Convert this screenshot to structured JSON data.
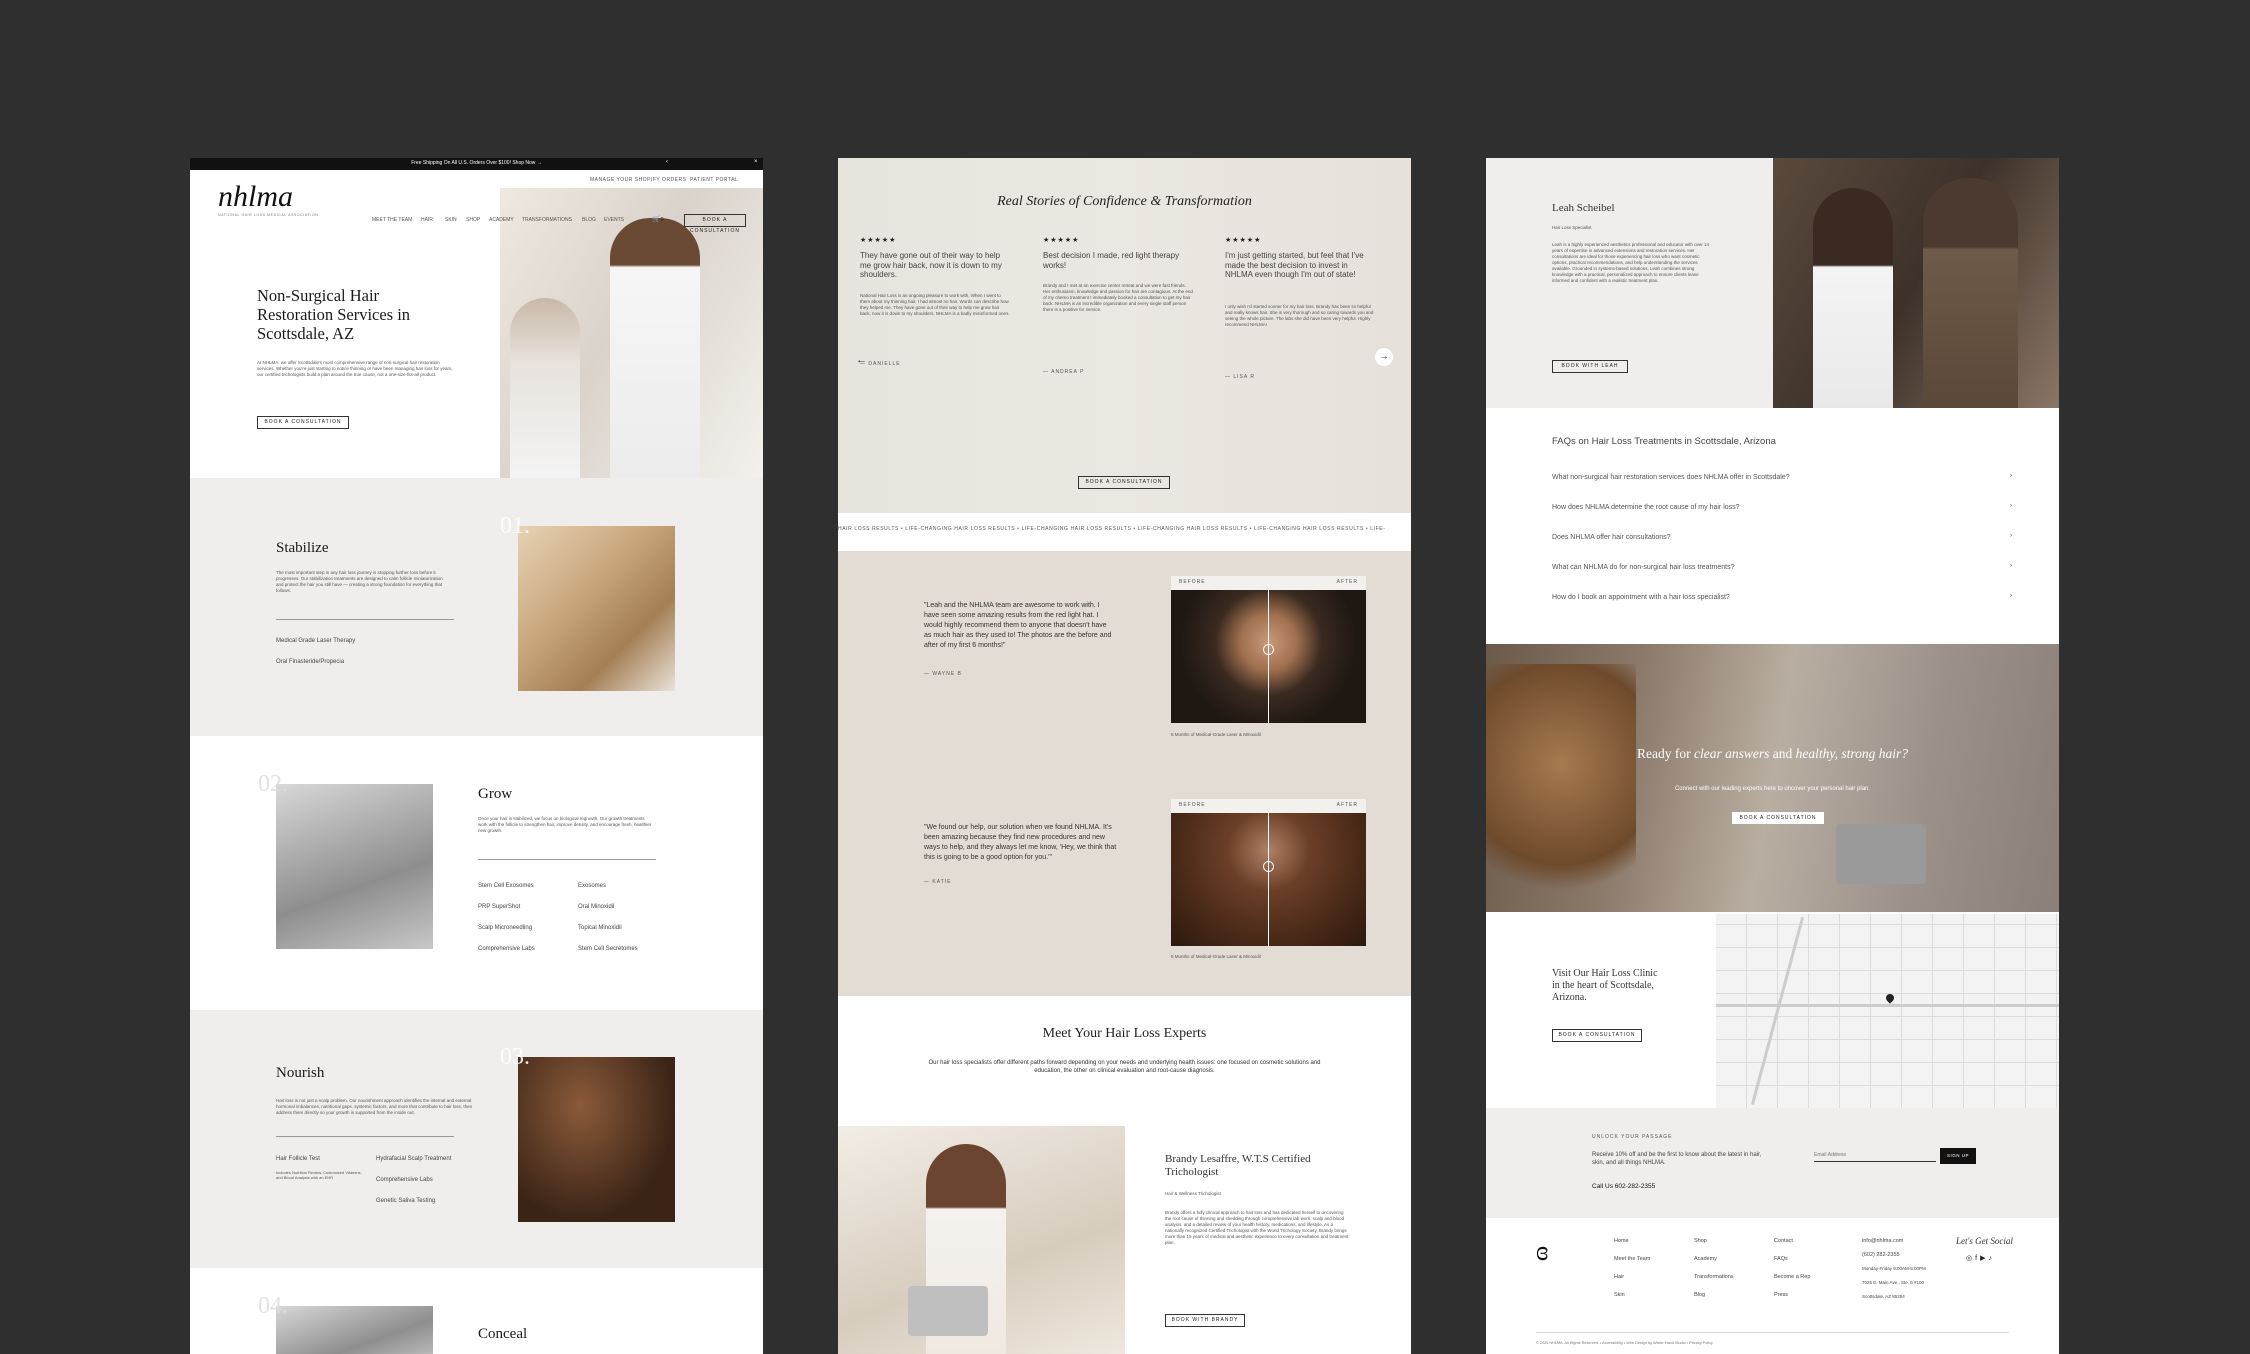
{
  "panel1": {
    "announcement": "Free Shipping On All U.S. Orders Over $100! Shop Now →",
    "top_links": [
      "MANAGE YOUR SHOPIFY ORDERS",
      "PATIENT PORTAL"
    ],
    "logo": "nhlma",
    "logo_tagline": "NATIONAL HAIR LOSS MEDICAL ASSOCIATION",
    "nav": [
      "MEET THE TEAM",
      "HAIR",
      "SKIN",
      "SHOP",
      "ACADEMY",
      "TRANSFORMATIONS",
      "BLOG",
      "EVENTS"
    ],
    "cart_count": "0",
    "nav_cta": "BOOK A CONSULTATION",
    "hero_title": "Non-Surgical Hair Restoration Services in Scottsdale, AZ",
    "hero_body": "At NHLMA, we offer Scottsdale's most comprehensive range of non-surgical hair restoration services. Whether you're just starting to notice thinning or have been managing hair loss for years, our certified trichologists build a plan around the true cause, not a one-size-fits-all product.",
    "hero_cta": "BOOK A CONSULTATION",
    "stabilize": {
      "num": "01.",
      "title": "Stabilize",
      "body": "The most important step in any hair loss journey is stopping further loss before it progresses. Our stabilization treatments are designed to calm follicle miniaturization and protect the hair you still have — creating a strong foundation for everything that follows.",
      "items": [
        "Medical Grade Laser Therapy",
        "Oral Finasteride/Propecia"
      ]
    },
    "grow": {
      "num": "02.",
      "title": "Grow",
      "body": "Once your hair is stabilized, we focus on biological regrowth. Our growth treatments work with the follicle to strengthen hair, improve density, and encourage fresh, healthier new growth.",
      "items_left": [
        "Stem Cell Exosomes",
        "PRP SuperShot",
        "Scalp Microneedling",
        "Comprehensive Labs"
      ],
      "items_right": [
        "Exosomes",
        "Oral Minoxidil",
        "Topical Minoxidil",
        "Stem Cell Secretomes"
      ]
    },
    "nourish": {
      "num": "03.",
      "title": "Nourish",
      "body": "Hair loss is not just a scalp problem. Our nourishment approach identifies the internal and external hormonal imbalances, nutritional gaps, systemic factors, and more that contribute to hair loss, then address them directly so your growth is supported from the inside out.",
      "items_left": [
        "Hair Follicle Test",
        "Includes Nutrition Review, Customized Vitamins, and Blood Analysis with an EHR"
      ],
      "items_right": [
        "Hydrafacial Scalp Treatment",
        "Comprehensive Labs",
        "Genetic Saliva Testing"
      ]
    },
    "conceal": {
      "num": "04.",
      "title": "Conceal"
    }
  },
  "panel2": {
    "reviews_title": "Real Stories of Confidence & Transformation",
    "reviews": [
      {
        "stars": "★★★★★",
        "headline": "They have gone out of their way to help me grow hair back, now it is down to my shoulders.",
        "body": "National Hair Loss is an ongoing pleasure to work with. When I went to them about my thinning hair, I had almost no hair. Words can describe how they helped me. They have gone out of their way to help me grow hair back, now it is down to my shoulders. NHLMA is a badly misinformed ones.",
        "author": "— DANIELLE"
      },
      {
        "stars": "★★★★★",
        "headline": "Best decision I made, red light therapy works!",
        "body": "Brandy and I met at an exercise center retreat and we were fast friends. Her enthusiasm, knowledge and passion for hair are contagious. At the end of my chemo treatment I immediately booked a consultation to get my hair back. NHLMA is an incredible organization and every single staff person there is a positive for service.",
        "author": "— ANDREA P"
      },
      {
        "stars": "★★★★★",
        "headline": "I'm just getting started, but feel that I've made the best decision to invest in NHLMA even though I'm out of state!",
        "body": "I only wish I'd started sooner for my hair loss. Brandy has been so helpful and really knows hair. She is very thorough and so caring towards you and seeing the whole picture. The labs she did have been very helpful. Highly recommend NHLMA!",
        "author": "— LISA R"
      }
    ],
    "reviews_cta": "BOOK A CONSULTATION",
    "ticker": "HAIR LOSS RESULTS • LIFE-CHANGING HAIR LOSS RESULTS • LIFE-CHANGING HAIR LOSS RESULTS • LIFE-CHANGING HAIR LOSS RESULTS • LIFE-CHANGING HAIR LOSS RESULTS • LIFE-",
    "results": [
      {
        "quote": "\"Leah and the NHLMA team are awesome to work with. I have seen some amazing results from the red light hat. I would highly recommend them to anyone that doesn't have as much hair as they used to! The photos are the before and after of my first 6 months!\"",
        "author": "— WAYNE B",
        "before": "BEFORE",
        "after": "AFTER",
        "caption": "6 Months of Medical-Grade Laser & Minoxidil"
      },
      {
        "quote": "\"We found our help, our solution when we found NHLMA. It's been amazing because they find new procedures and new ways to help, and they always let me know, 'Hey, we think that this is going to be a good option for you.'\"",
        "author": "— KATIE",
        "before": "BEFORE",
        "after": "AFTER",
        "caption": "6 Months of Medical-Grade Laser & Minoxidil"
      }
    ],
    "experts_title": "Meet Your Hair Loss Experts",
    "experts_body": "Our hair loss specialists offer different paths forward depending on your needs and underlying health issues: one focused on cosmetic solutions and education, the other on clinical evaluation and root-cause diagnosis.",
    "expert": {
      "name": "Brandy Lesaffre, W.T.S Certified Trichologist",
      "role": "Hair & Wellness Trichologist",
      "body": "Brandy offers a fully clinical approach to hair loss and has dedicated herself to uncovering the root cause of thinning and shedding through comprehensive lab work, scalp and blood analysis, and a detailed review of your health history, medications, and lifestyle. As a nationally recognized Certified Trichologist with the World Trichology Society, Brandy brings more than 15 years of medical and aesthetic experience to every consultation and treatment plan.",
      "cta": "BOOK WITH BRANDY"
    }
  },
  "panel3": {
    "leah": {
      "name": "Leah Scheibel",
      "role": "Hair Loss Specialist",
      "body": "Leah is a highly experienced aesthetics professional and educator with over 14 years of expertise in advanced extensions and restoration services. Her consultations are ideal for those experiencing hair loss who want cosmetic options, practical recommendations, and help understanding the services available. Grounded in systems-based solutions, Leah combines strong knowledge with a practical, personalized approach to ensure clients leave informed and confident with a realistic treatment plan.",
      "cta": "BOOK WITH LEAH"
    },
    "faq_title": "FAQs on Hair Loss Treatments in Scottsdale, Arizona",
    "faqs": [
      "What non-surgical hair restoration services does NHLMA offer in Scottsdale?",
      "How does NHLMA determine the root cause of my hair loss?",
      "Does NHLMA offer hair consultations?",
      "What can NHLMA do for non-surgical hair loss treatments?",
      "How do I book an appointment with a hair loss specialist?"
    ],
    "cta_title_plain": "Ready for ",
    "cta_title_em1": "clear answers",
    "cta_title_mid": " and ",
    "cta_title_em2": "healthy, strong hair?",
    "cta_body": "Connect with our leading experts here to uncover your personal hair plan.",
    "cta_button": "BOOK A CONSULTATION",
    "visit_title": "Visit Our Hair Loss Clinic in the heart of Scottsdale, Arizona.",
    "visit_cta": "BOOK A CONSULTATION",
    "newsletter": {
      "eyebrow": "UNLOCK YOUR PASSAGE",
      "body": "Receive 10% off and be the first to know about the latest in hair, skin, and all things NHLMA.",
      "phone": "Call Us 602-282-2355",
      "placeholder": "Email Address",
      "button": "SIGN UP"
    },
    "footer": {
      "col1": [
        "Home",
        "Meet the Team",
        "Hair",
        "Skin"
      ],
      "col2": [
        "Shop",
        "Academy",
        "Transformations",
        "Blog"
      ],
      "col3": [
        "Contact",
        "FAQs",
        "Become a Rep",
        "Press"
      ],
      "contact": [
        "info@nhlma.com",
        "(602) 282-2355",
        "Monday-Friday 9:00AM-5:00PM",
        "7025 E. Main Ave., Ste. 6 #100",
        "Scottsdale, AZ 85254"
      ],
      "social_title": "Let's Get Social",
      "copyright": "© 2025 NHLMA. All Rights Reserved. • Accessibility • Web Design by Wilder Hand Studio • Privacy Policy"
    }
  }
}
